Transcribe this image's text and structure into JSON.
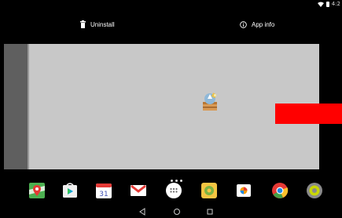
{
  "status_bar": {
    "time": "4:2"
  },
  "action_bar": {
    "uninstall_label": "Uninstall",
    "app_info_label": "App info"
  },
  "dock": {
    "apps": [
      {
        "name": "Maps",
        "icon": "maps-icon"
      },
      {
        "name": "Play Store",
        "icon": "play-store-icon"
      },
      {
        "name": "Calendar",
        "icon": "calendar-icon",
        "day": "31"
      },
      {
        "name": "Gmail",
        "icon": "gmail-icon"
      },
      {
        "name": "All apps",
        "icon": "app-drawer-icon"
      },
      {
        "name": "Gallery",
        "icon": "gallery-icon"
      },
      {
        "name": "Photos",
        "icon": "photos-icon"
      },
      {
        "name": "Chrome",
        "icon": "chrome-icon"
      },
      {
        "name": "Settings",
        "icon": "settings-icon"
      }
    ]
  },
  "nav_bar": {
    "buttons": [
      "back",
      "home",
      "recents"
    ]
  },
  "colors": {
    "background": "#000000",
    "preview_bg": "#c8c8c8",
    "left_panel": "#5f5f5f",
    "highlight": "#ff0000"
  }
}
